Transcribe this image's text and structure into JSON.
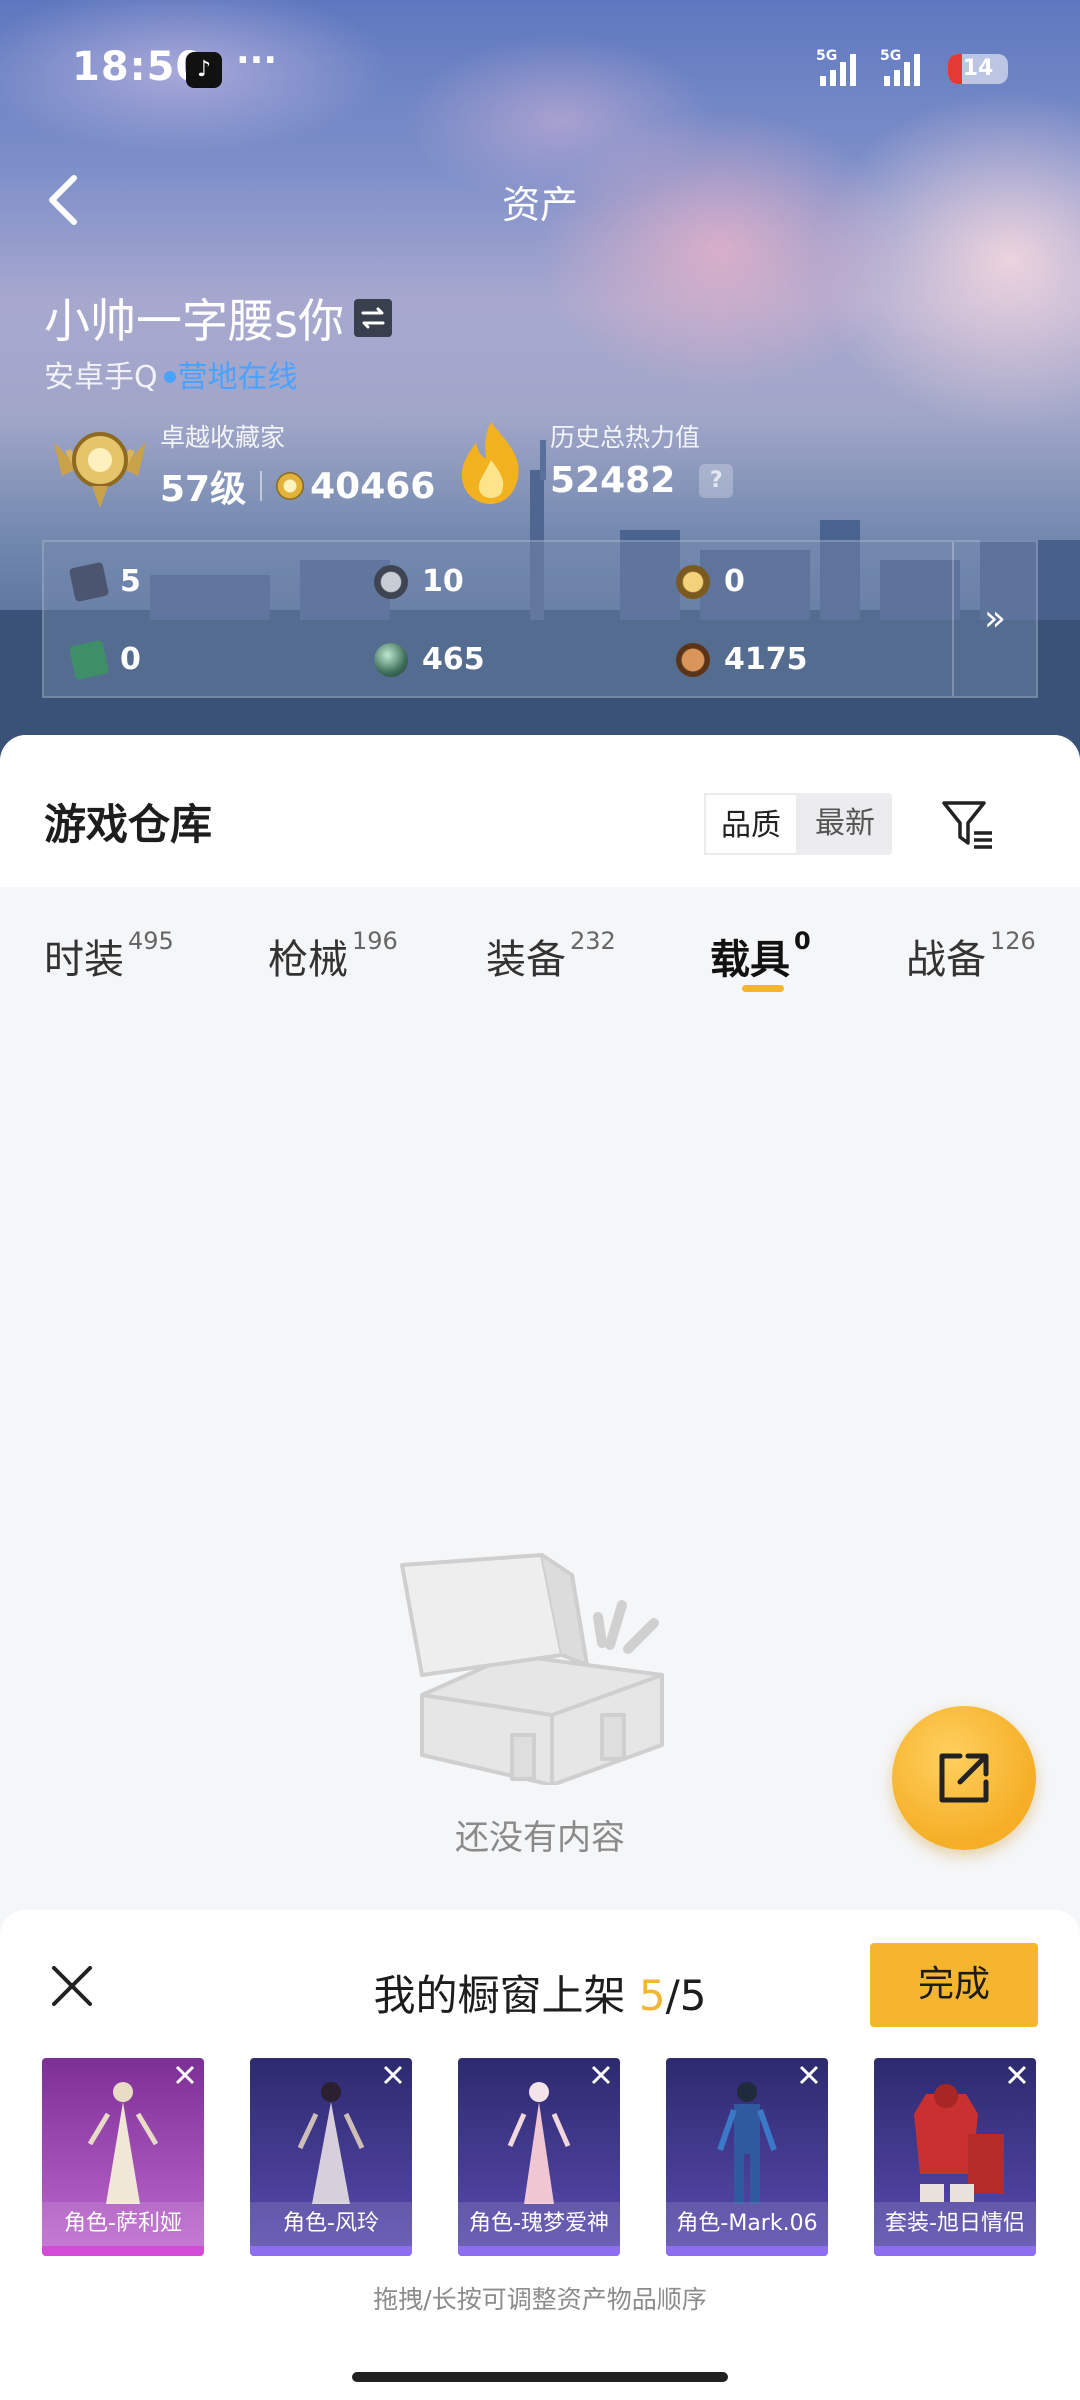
{
  "status_bar": {
    "time": "18:50",
    "battery": "14",
    "network_1": "5G",
    "network_2": "5G"
  },
  "nav": {
    "title": "资产"
  },
  "profile": {
    "username": "小帅一字腰s你",
    "platform": "安卓手Q",
    "online_status": "营地在线",
    "collector": {
      "label": "卓越收藏家",
      "level": "57级",
      "points": "40466"
    },
    "heat": {
      "label": "历史总热力值",
      "value": "52482"
    }
  },
  "currencies": [
    {
      "icon": "card-ticket-icon",
      "value": "5"
    },
    {
      "icon": "silver-coin-icon",
      "value": "10"
    },
    {
      "icon": "gold-token-icon",
      "value": "0"
    },
    {
      "icon": "green-card-icon",
      "value": "0"
    },
    {
      "icon": "green-orb-icon",
      "value": "465"
    },
    {
      "icon": "bronze-shield-icon",
      "value": "4175"
    }
  ],
  "warehouse": {
    "title": "游戏仓库",
    "sort": {
      "options": [
        "品质",
        "最新"
      ],
      "active": "品质"
    },
    "tabs": [
      {
        "label": "时装",
        "count": "495"
      },
      {
        "label": "枪械",
        "count": "196"
      },
      {
        "label": "装备",
        "count": "232"
      },
      {
        "label": "载具",
        "count": "0"
      },
      {
        "label": "战备",
        "count": "126"
      }
    ],
    "active_tab": "载具",
    "empty_text": "还没有内容"
  },
  "showcase": {
    "title": "我的橱窗上架",
    "count_current": "5",
    "count_total": "/5",
    "done_label": "完成",
    "items": [
      {
        "label": "角色-萨利娅",
        "theme": "#9b3fb5"
      },
      {
        "label": "角色-风玲",
        "theme": "#5a4bb0"
      },
      {
        "label": "角色-瑰梦爱神",
        "theme": "#5a4bb0"
      },
      {
        "label": "角色-Mark.06",
        "theme": "#5a4bb0"
      },
      {
        "label": "套装-旭日情侣",
        "theme": "#5a4bb0"
      }
    ],
    "hint": "拖拽/长按可调整资产物品顺序"
  },
  "colors": {
    "accent": "#f5b52e",
    "online": "#4aa2ff",
    "legendary": "#9b3fb5",
    "epic": "#5a4bb0"
  }
}
